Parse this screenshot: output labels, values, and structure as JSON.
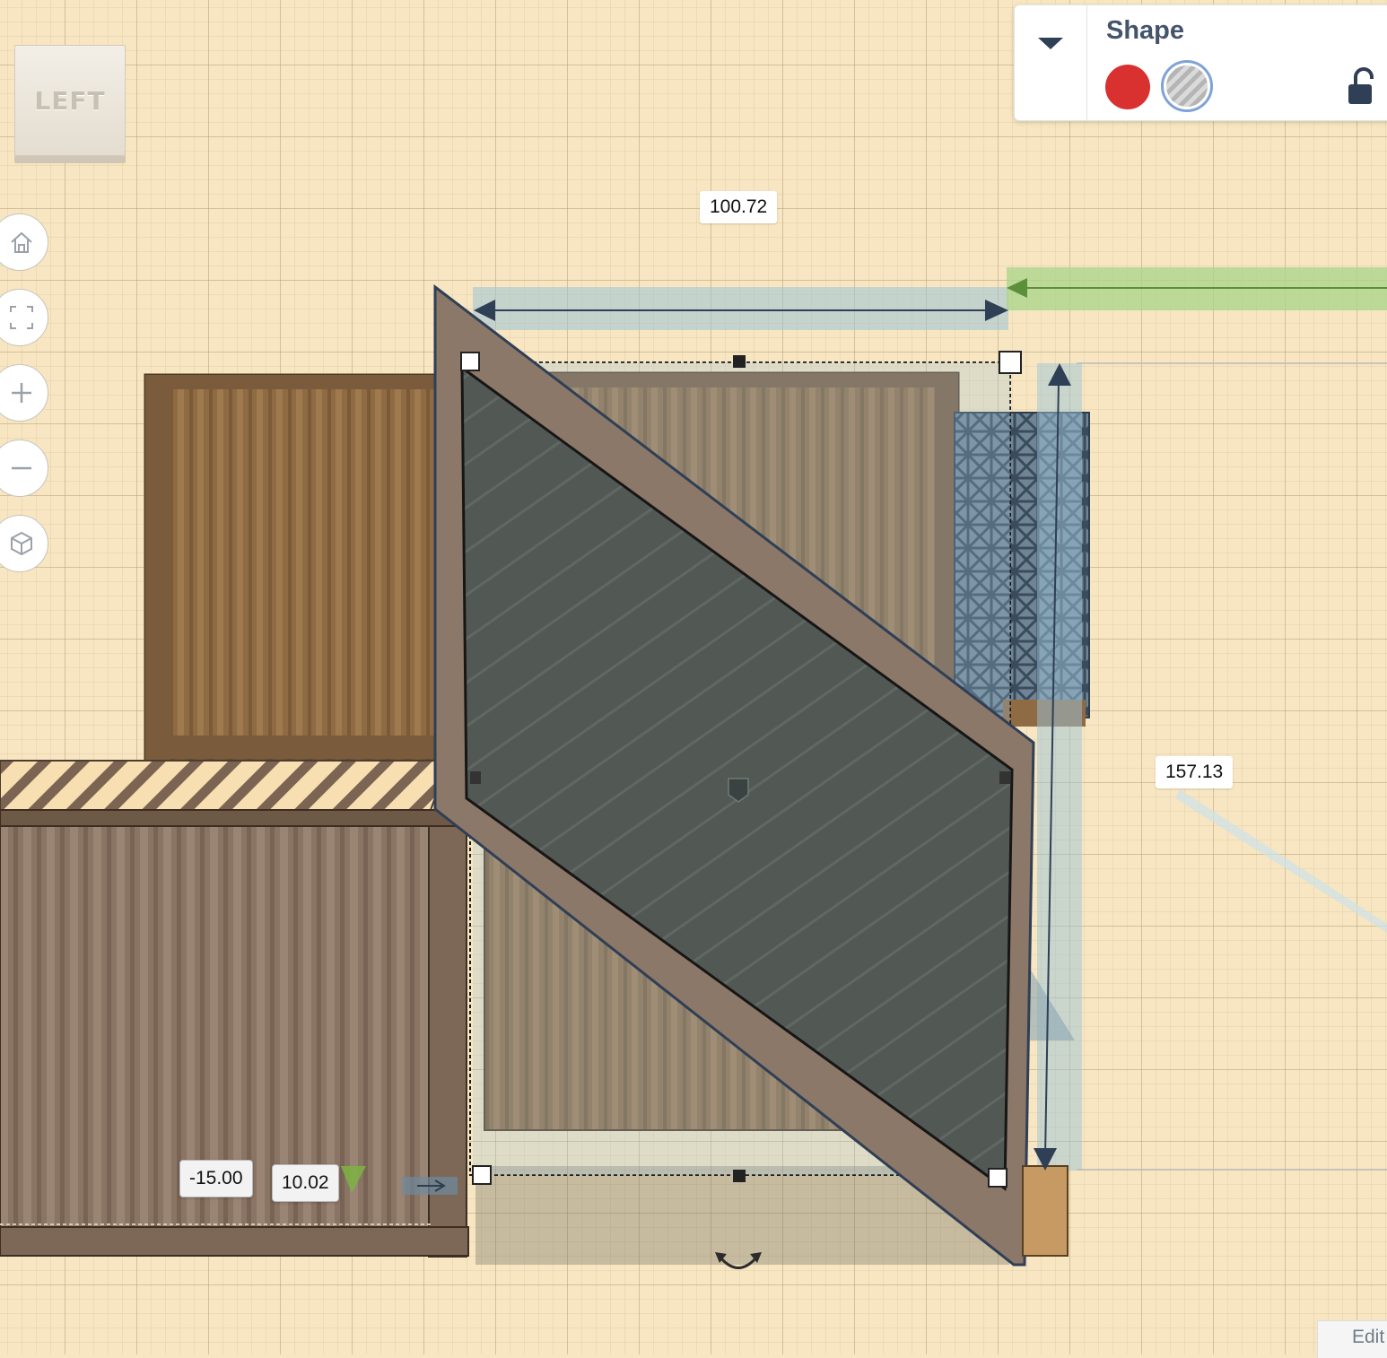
{
  "viewcube": {
    "face_label": "LEFT"
  },
  "nav": {
    "buttons": [
      "home-view",
      "fit-all",
      "zoom-in",
      "zoom-out",
      "perspective"
    ]
  },
  "inspector": {
    "title": "Shape",
    "solid_color": "#d8312f",
    "hole_selected": true,
    "accent": "#7fa3d6"
  },
  "dimensions": {
    "width": "100.72",
    "height": "157.13",
    "elevation": "-15.00",
    "depth_offset": "10.02"
  },
  "footer": {
    "edit_label": "Edit"
  },
  "colors": {
    "workplane": "#f7e6c1",
    "container": "#8c6a46",
    "hole": "#4e5753",
    "selection": "#9dc3d7"
  }
}
